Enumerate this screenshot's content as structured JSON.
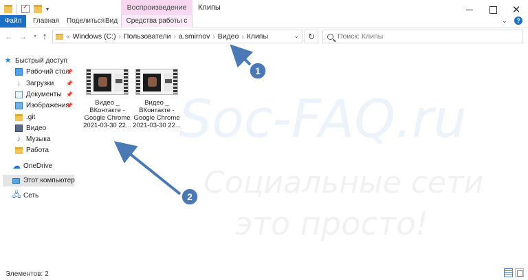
{
  "window": {
    "title": "Клипы",
    "contextual_tab_group": "Воспроизведение"
  },
  "ribbon": {
    "tabs": [
      {
        "label": "Файл"
      },
      {
        "label": "Главная"
      },
      {
        "label": "Поделиться"
      },
      {
        "label": "Вид"
      },
      {
        "label": "Средства работы с видео"
      }
    ]
  },
  "address": {
    "breadcrumbs": [
      "Windows (C:)",
      "Пользователи",
      "a.smirnov",
      "Видео",
      "Клипы"
    ],
    "search_placeholder": "Поиск: Клипы"
  },
  "navigation": {
    "quick_access_label": "Быстрый доступ",
    "items": [
      {
        "label": "Рабочий стол",
        "icon": "desktop-icon",
        "pinned": true
      },
      {
        "label": "Загрузки",
        "icon": "download-icon",
        "pinned": true
      },
      {
        "label": "Документы",
        "icon": "documents-icon",
        "pinned": true
      },
      {
        "label": "Изображения",
        "icon": "pictures-icon",
        "pinned": true
      },
      {
        "label": ".git",
        "icon": "folder-icon",
        "pinned": false
      },
      {
        "label": "Видео",
        "icon": "videos-icon",
        "pinned": false
      },
      {
        "label": "Музыка",
        "icon": "music-icon",
        "pinned": false
      },
      {
        "label": "Работа",
        "icon": "folder-icon",
        "pinned": false
      }
    ],
    "onedrive_label": "OneDrive",
    "this_pc_label": "Этот компьютер",
    "network_label": "Сеть"
  },
  "files": [
    {
      "line1": "Видео _",
      "line2": "ВКонтакте -",
      "line3": "Google Chrome",
      "line4": "2021-03-30 22..."
    },
    {
      "line1": "Видео _",
      "line2": "ВКонтакте -",
      "line3": "Google Chrome",
      "line4": "2021-03-30 22..."
    }
  ],
  "status": {
    "item_count": "Элементов: 2"
  },
  "watermark": {
    "brand": "Soc-FAQ.ru",
    "tagline_1": "Социальные сети",
    "tagline_2": "это просто!"
  },
  "annotations": [
    {
      "number": "1"
    },
    {
      "number": "2"
    }
  ],
  "colors": {
    "accent": "#1a6fc6",
    "contextual_tab": "#f6d7ef",
    "annotation_badge": "#4a7ab5"
  }
}
